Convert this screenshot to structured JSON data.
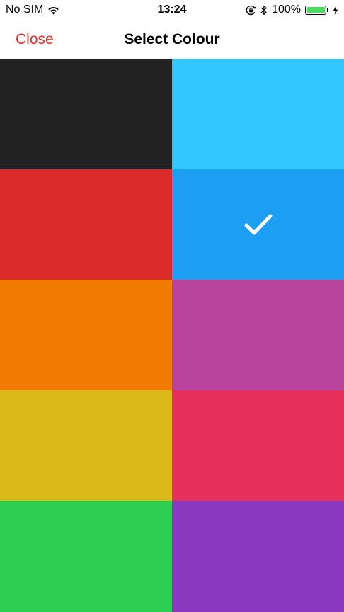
{
  "status_bar": {
    "carrier": "No SIM",
    "time": "13:24",
    "battery_percent": "100%",
    "battery_level": 1.0,
    "battery_color": "#4cd964",
    "icons": [
      "wifi-icon",
      "orientation-lock-icon",
      "bluetooth-icon",
      "battery-icon",
      "charging-bolt-icon"
    ]
  },
  "nav": {
    "close_label": "Close",
    "title": "Select Colour",
    "accent_color": "#e0312d"
  },
  "colours": [
    {
      "id": "black",
      "hex": "#222222",
      "selected": false
    },
    {
      "id": "light-blue",
      "hex": "#33c8fd",
      "selected": false
    },
    {
      "id": "red",
      "hex": "#db2b2a",
      "selected": false
    },
    {
      "id": "blue",
      "hex": "#1c9ef2",
      "selected": true
    },
    {
      "id": "orange",
      "hex": "#f27a00",
      "selected": false
    },
    {
      "id": "magenta",
      "hex": "#b9449e",
      "selected": false
    },
    {
      "id": "yellow",
      "hex": "#dbb81a",
      "selected": false
    },
    {
      "id": "pink-red",
      "hex": "#e5305c",
      "selected": false
    },
    {
      "id": "green",
      "hex": "#2dce51",
      "selected": false
    },
    {
      "id": "purple",
      "hex": "#8839bf",
      "selected": false
    }
  ],
  "selected_icon": "checkmark-icon"
}
